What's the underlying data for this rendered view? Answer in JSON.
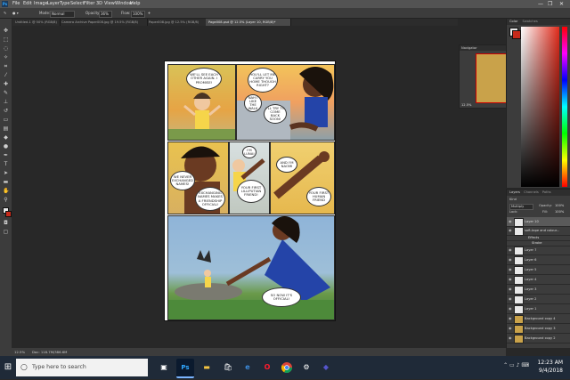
{
  "menubar": {
    "logo": "Ps",
    "items": [
      "File",
      "Edit",
      "Image",
      "Layer",
      "Type",
      "Select",
      "Filter",
      "3D",
      "View",
      "Window",
      "Help"
    ],
    "window_controls": [
      "—",
      "❐",
      "✕"
    ]
  },
  "options": {
    "mode_label": "Mode:",
    "mode_value": "Normal",
    "opacity_label": "Opacity:",
    "opacity_value": "36%",
    "flow_label": "Flow:",
    "flow_value": "100%"
  },
  "tabs": [
    {
      "label": "Untitled-1 @ 50% (RGB/8)",
      "active": false
    },
    {
      "label": "Camera Archive Paper008.jpg @ 19.5% (RGB/8)",
      "active": false
    },
    {
      "label": "Paper008.jpg @ 12.5% (RGB/8)",
      "active": false
    },
    {
      "label": "Page008.psd @ 12.5% (Layer 10, RGB/8)*",
      "active": true
    }
  ],
  "comic": {
    "bubbles": {
      "b1": "WE'LL SEE EACH OTHER AGAIN. I PROMISE!",
      "b2": "YOU'LL LET ME CARRY YOU HOME THOUGH RIGHT?",
      "b3": "NAH I LIKE THE WALK",
      "b4": "I'LL TRY TO COME BACK SOON!",
      "b5": "WE NEVER EXCHANGED NAMES!",
      "b6": "EXCHANGING NAMES MAKES A FRIENDSHIP OFFICIAL!",
      "b7": "I'M LUNA!",
      "b8": "YOUR FIRST LILLIPUTIAN FRIEND!",
      "b9": "AND I'M NAOMI",
      "b10": "YOUR FIRST HUMAN FRIEND",
      "b11": "SO NOW IT'S OFFICIAL!"
    }
  },
  "navigator": {
    "title": "Navigator",
    "zoom": "12.5%"
  },
  "color_panel": {
    "tabs": [
      "Color",
      "Swatches"
    ]
  },
  "layers": {
    "tabs": [
      "Layers",
      "Channels",
      "Paths"
    ],
    "kind_label": "Kind",
    "blend": "Multiply",
    "opacity_label": "Opacity:",
    "opacity_value": "100%",
    "lock_label": "Lock:",
    "fill_label": "Fill:",
    "fill_value": "100%",
    "rows": [
      {
        "name": "Layer 10",
        "selected": true
      },
      {
        "name": "soft-tape and colour...",
        "selected": false
      },
      {
        "name": "Effects",
        "selected": false
      },
      {
        "name": "Stroke",
        "selected": false
      },
      {
        "name": "Layer 7",
        "selected": false
      },
      {
        "name": "Layer 6",
        "selected": false
      },
      {
        "name": "Layer 5",
        "selected": false
      },
      {
        "name": "Layer 4",
        "selected": false
      },
      {
        "name": "Layer 3",
        "selected": false
      },
      {
        "name": "Layer 2",
        "selected": false
      },
      {
        "name": "Layer 1",
        "selected": false
      },
      {
        "name": "Background copy 4",
        "selected": false
      },
      {
        "name": "Background copy 3",
        "selected": false
      },
      {
        "name": "Background copy 2",
        "selected": false
      },
      {
        "name": "Background copy",
        "selected": false
      },
      {
        "name": "Background",
        "selected": false
      }
    ]
  },
  "status": {
    "zoom": "12.5%",
    "doc": "Doc: 118.7M/386.6M"
  },
  "taskbar": {
    "start_icon": "windows-logo",
    "search_placeholder": "Type here to search",
    "apps": [
      "cortana",
      "task-view",
      "photoshop",
      "file-explorer",
      "store",
      "edge",
      "opera",
      "chrome",
      "settings",
      "app"
    ],
    "time": "12:23 AM",
    "date": "9/4/2018"
  },
  "colors": {
    "fg": "#e8e8e8",
    "bg": "#c62a1b",
    "taskbar": "#1f2a38",
    "ps_blue": "#31a8ff"
  }
}
